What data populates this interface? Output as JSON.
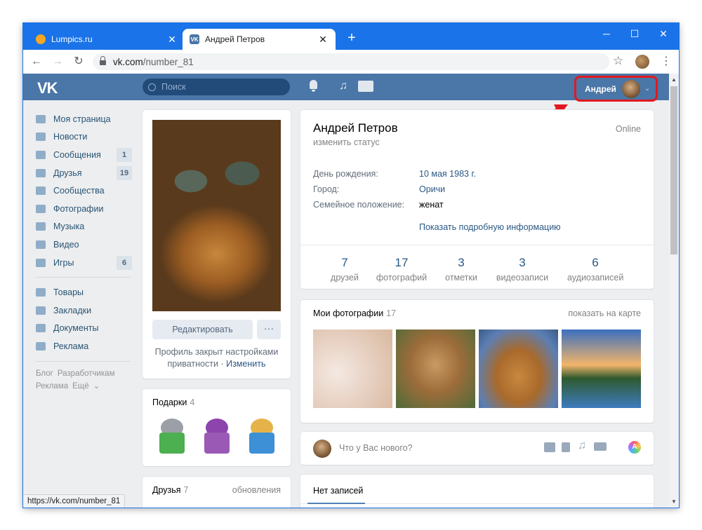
{
  "browser": {
    "tabs": [
      {
        "title": "Lumpics.ru",
        "active": false
      },
      {
        "title": "Андрей Петров",
        "active": true
      }
    ],
    "new_tab": "+",
    "url_host": "vk.com",
    "url_path": "/number_81",
    "status_url": "https://vk.com/number_81",
    "accent": "#1a73e8"
  },
  "vk": {
    "logo": "VK",
    "search_placeholder": "Поиск",
    "user_name": "Андрей",
    "brand_color": "#4a76a8",
    "highlight_color": "#e1191f"
  },
  "menu": {
    "items": [
      {
        "label": "Моя страница",
        "icon": "home-icon",
        "count": ""
      },
      {
        "label": "Новости",
        "icon": "news-icon",
        "count": ""
      },
      {
        "label": "Сообщения",
        "icon": "messages-icon",
        "count": "1"
      },
      {
        "label": "Друзья",
        "icon": "friends-icon",
        "count": "19"
      },
      {
        "label": "Сообщества",
        "icon": "groups-icon",
        "count": ""
      },
      {
        "label": "Фотографии",
        "icon": "camera-icon",
        "count": ""
      },
      {
        "label": "Музыка",
        "icon": "music-icon",
        "count": ""
      },
      {
        "label": "Видео",
        "icon": "video-icon",
        "count": ""
      },
      {
        "label": "Игры",
        "icon": "gamepad-icon",
        "count": "6"
      }
    ],
    "items2": [
      {
        "label": "Товары",
        "icon": "bag-icon"
      },
      {
        "label": "Закладки",
        "icon": "star-icon"
      },
      {
        "label": "Документы",
        "icon": "document-icon"
      },
      {
        "label": "Реклама",
        "icon": "megaphone-icon"
      }
    ],
    "footer": [
      "Блог",
      "Разработчикам",
      "Реклама",
      "Ещё"
    ]
  },
  "avatar_card": {
    "edit_label": "Редактировать",
    "more_label": "···",
    "privacy_text": "Профиль закрыт настройками приватности",
    "privacy_sep": "·",
    "privacy_link": "Изменить"
  },
  "gifts": {
    "title": "Подарки",
    "count": "4"
  },
  "friends_block": {
    "title": "Друзья",
    "count": "7",
    "updates": "обновления"
  },
  "profile": {
    "name": "Андрей Петров",
    "status": "изменить статус",
    "online": "Online",
    "rows": [
      {
        "label": "День рождения:",
        "value": "10 мая 1983 г."
      },
      {
        "label": "Город:",
        "value": "Оричи"
      },
      {
        "label": "Семейное положение:",
        "value": "женат"
      }
    ],
    "more_info": "Показать подробную информацию",
    "stats": [
      {
        "value": "7",
        "label": "друзей"
      },
      {
        "value": "17",
        "label": "фотографий"
      },
      {
        "value": "3",
        "label": "отметки"
      },
      {
        "value": "3",
        "label": "видеозаписи"
      },
      {
        "value": "6",
        "label": "аудиозаписей"
      }
    ]
  },
  "photos": {
    "title": "Мои фотографии",
    "count": "17",
    "map_link": "показать на карте",
    "items": [
      "white-fox-photo",
      "kitten-photo",
      "dog-flowers-photo",
      "lake-sunset-photo"
    ]
  },
  "composer": {
    "placeholder": "Что у Вас нового?",
    "a_label": "A"
  },
  "wall": {
    "tab": "Нет записей"
  }
}
